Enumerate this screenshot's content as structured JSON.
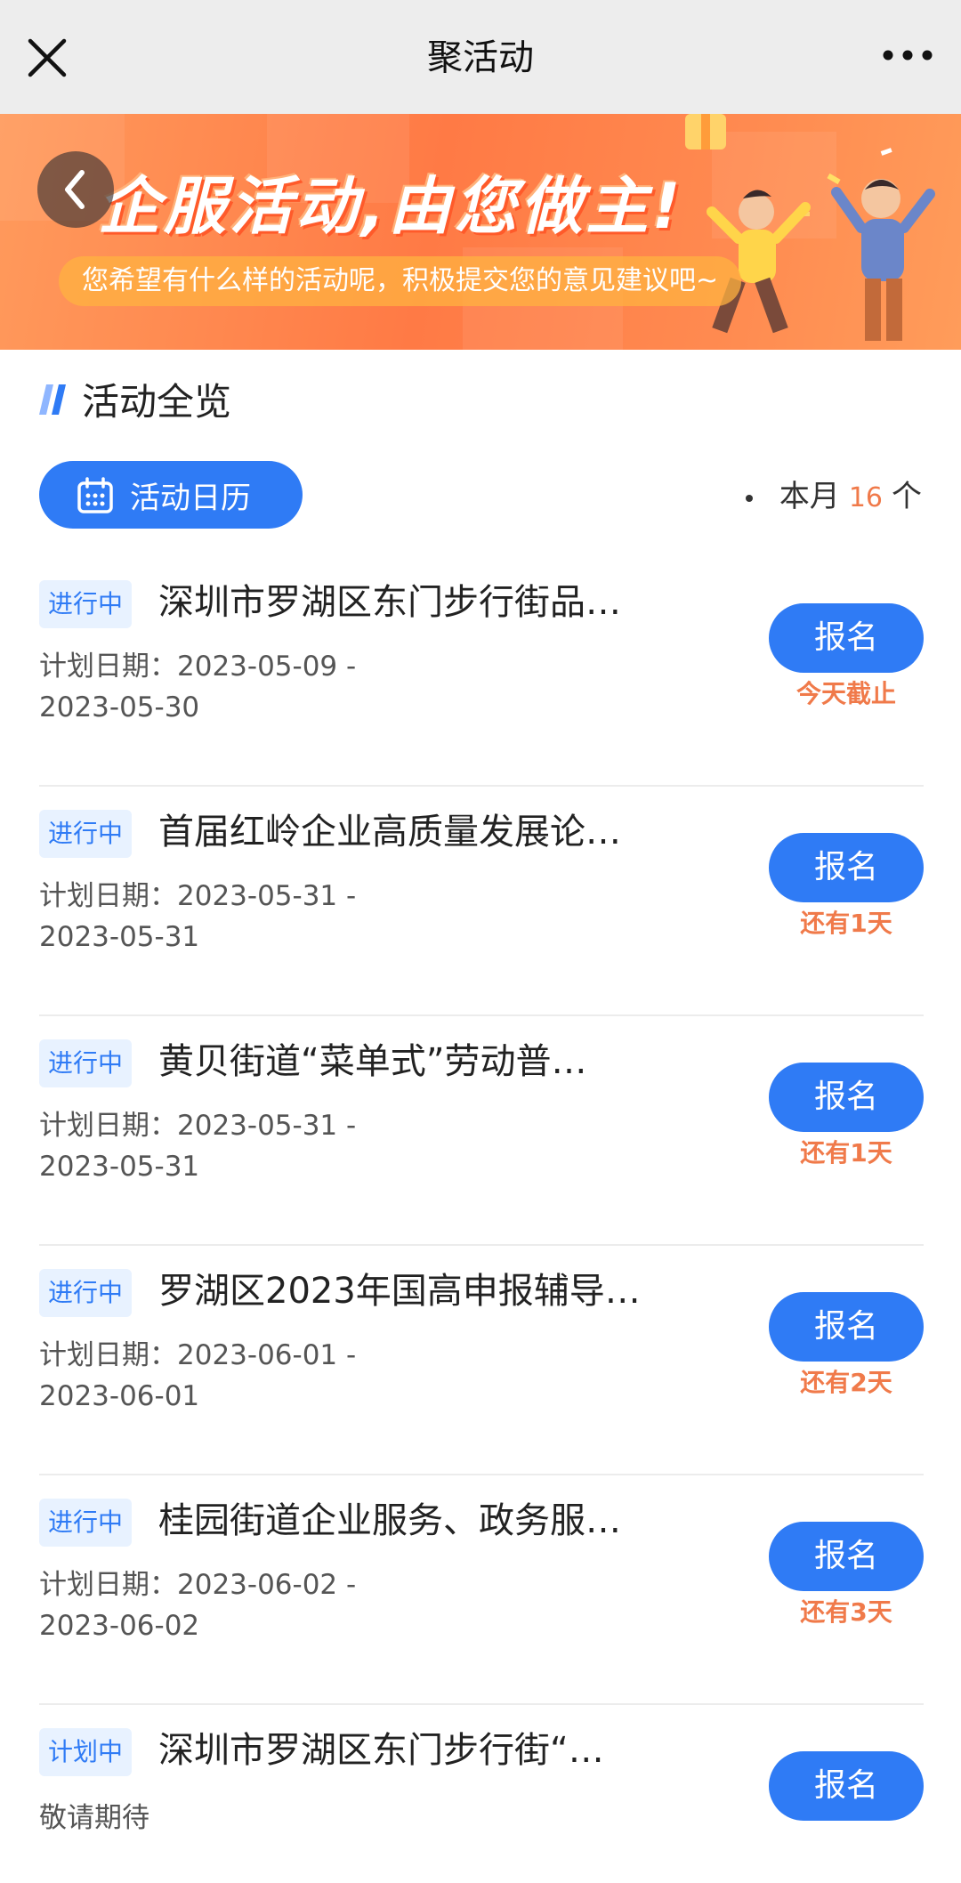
{
  "navbar": {
    "title": "聚活动",
    "close_icon": "close-icon",
    "more_icon": "more-icon"
  },
  "banner": {
    "title": "企服活动,由您做主!",
    "subtitle": "您希望有什么样的活动呢，积极提交您的意见建议吧~",
    "back_icon": "chevron-left-icon"
  },
  "section": {
    "title": "活动全览"
  },
  "toolbar": {
    "calendar_label": "活动日历",
    "calendar_icon": "calendar-icon",
    "month_prefix": "本月",
    "month_count": "16",
    "month_suffix": "个"
  },
  "activities": [
    {
      "status": "进行中",
      "title": "深圳市罗湖区东门步行街品…",
      "date_label": "计划日期：",
      "date_start": "2023-05-09 -",
      "date_end": "2023-05-30",
      "button": "报名",
      "deadline": "今天截止"
    },
    {
      "status": "进行中",
      "title": "首届红岭企业高质量发展论…",
      "date_label": "计划日期：",
      "date_start": "2023-05-31 -",
      "date_end": "2023-05-31",
      "button": "报名",
      "deadline": "还有1天"
    },
    {
      "status": "进行中",
      "title": "黄贝街道“菜单式”劳动普…",
      "date_label": "计划日期：",
      "date_start": "2023-05-31 -",
      "date_end": "2023-05-31",
      "button": "报名",
      "deadline": "还有1天"
    },
    {
      "status": "进行中",
      "title": "罗湖区2023年国高申报辅导…",
      "date_label": "计划日期：",
      "date_start": "2023-06-01 -",
      "date_end": "2023-06-01",
      "button": "报名",
      "deadline": "还有2天"
    },
    {
      "status": "进行中",
      "title": "桂园街道企业服务、政务服…",
      "date_label": "计划日期：",
      "date_start": "2023-06-02 -",
      "date_end": "2023-06-02",
      "button": "报名",
      "deadline": "还有3天"
    },
    {
      "status": "计划中",
      "title": "深圳市罗湖区东门步行街“…",
      "date_note": "敬请期待",
      "button": "报名"
    }
  ],
  "colors": {
    "primary": "#2f7bf5",
    "accent": "#f07a4a",
    "badge_bg": "#e8f2ff",
    "navbar_bg": "#ededed"
  }
}
